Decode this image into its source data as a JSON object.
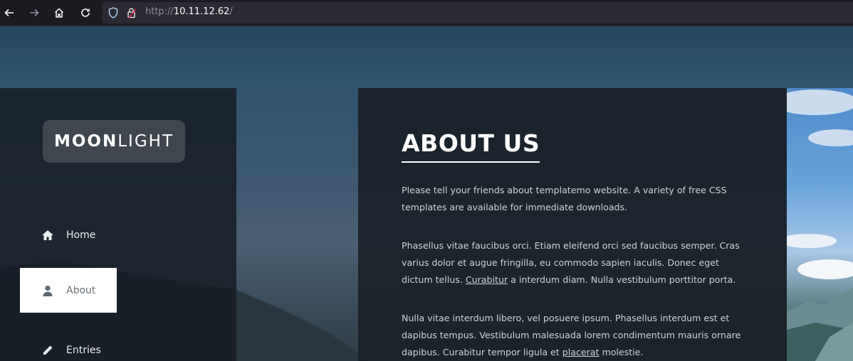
{
  "browser": {
    "url_scheme": "http://",
    "url_host": "10.11.12.62",
    "url_path": "/"
  },
  "logo": {
    "bold": "MOON",
    "light": "LIGHT"
  },
  "nav": [
    {
      "label": "Home",
      "icon": "home-icon",
      "active": false
    },
    {
      "label": "About",
      "icon": "user-icon",
      "active": true
    },
    {
      "label": "Entries",
      "icon": "pencil-icon",
      "active": false
    }
  ],
  "about": {
    "title": "ABOUT US",
    "p1": "Please tell your friends about templatemo website. A variety of free CSS templates are available for immediate downloads.",
    "p2_a": "Phasellus vitae faucibus orci. Etiam eleifend orci sed faucibus semper. Cras varius dolor et augue fringilla, eu commodo sapien iaculis. Donec eget dictum tellus. ",
    "p2_link": "Curabitur",
    "p2_b": " a interdum diam. Nulla vestibulum porttitor porta.",
    "p3_a": "Nulla vitae interdum libero, vel posuere ipsum. Phasellus interdum est et dapibus tempus. Vestibulum malesuada lorem condimentum mauris ornare dapibus. Curabitur tempor ligula et ",
    "p3_link": "placerat",
    "p3_b": " molestie."
  },
  "colors": {
    "accent": "#ffffff",
    "sidebar_bg": "#171e25",
    "content_bg": "#1a2128"
  }
}
